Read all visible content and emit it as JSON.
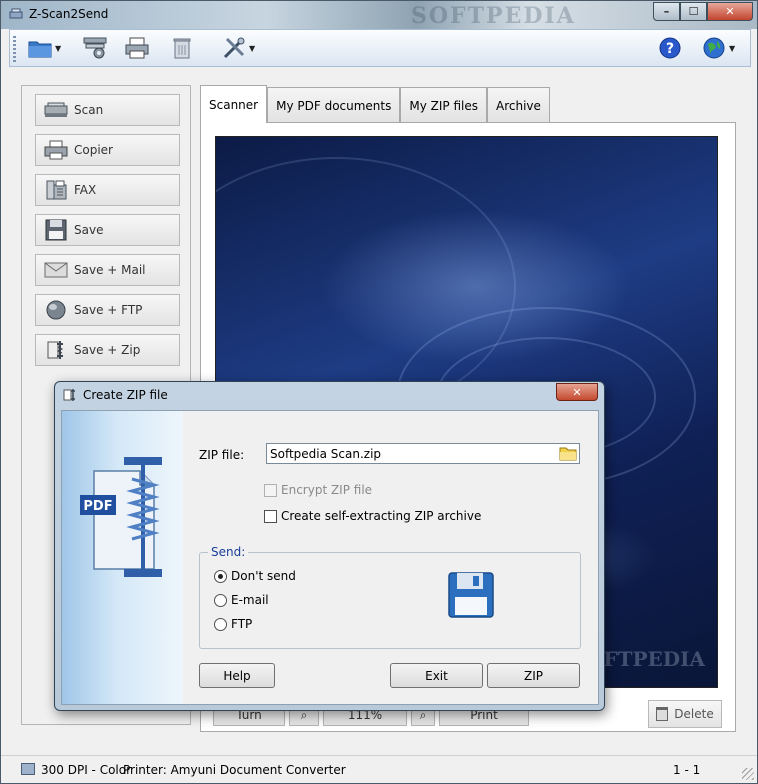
{
  "window": {
    "title": "Z-Scan2Send",
    "watermark": "SOFTPEDIA",
    "controls": {
      "minimize": "–",
      "maximize": "☐",
      "close": "✕"
    }
  },
  "toolbar": {
    "items": [
      "folder-icon",
      "scanner-settings-icon",
      "printer-icon",
      "recycle-bin-icon",
      "tools-icon",
      "help-icon",
      "globe-icon"
    ],
    "help_glyph": "?"
  },
  "sidebar": {
    "items": [
      {
        "label": "Scan",
        "icon": "scanner-icon"
      },
      {
        "label": "Copier",
        "icon": "copier-icon"
      },
      {
        "label": "FAX",
        "icon": "fax-icon"
      },
      {
        "label": "Save",
        "icon": "floppy-disk-icon"
      },
      {
        "label": "Save + Mail",
        "icon": "envelope-icon"
      },
      {
        "label": "Save + FTP",
        "icon": "ftp-globe-icon"
      },
      {
        "label": "Save + Zip",
        "icon": "zip-clamp-icon"
      }
    ]
  },
  "tabs": [
    {
      "label": "Scanner",
      "active": true
    },
    {
      "label": "My PDF documents",
      "active": false
    },
    {
      "label": "My ZIP files",
      "active": false
    },
    {
      "label": "Archive",
      "active": false
    }
  ],
  "preview": {
    "watermark": "SOFTPEDIA"
  },
  "bottom_bar": {
    "delete_label": "Delete",
    "hidden_labels": [
      "Turn",
      "111%",
      "Print"
    ]
  },
  "status": {
    "resolution": "300 DPI - Color",
    "printer": "Printer: Amyuni Document Converter",
    "page": "1 - 1"
  },
  "dialog": {
    "title": "Create ZIP file",
    "close": "✕",
    "art_label": "PDF",
    "zip_file_label": "ZIP file:",
    "zip_file_value": "Softpedia Scan.zip",
    "encrypt_label": "Encrypt ZIP file",
    "self_extract_label": "Create self-extracting ZIP archive",
    "send_legend": "Send:",
    "send_options": [
      {
        "label": "Don't send",
        "selected": true
      },
      {
        "label": "E-mail",
        "selected": false
      },
      {
        "label": "FTP",
        "selected": false
      }
    ],
    "buttons": {
      "help": "Help",
      "exit": "Exit",
      "zip": "ZIP"
    }
  }
}
